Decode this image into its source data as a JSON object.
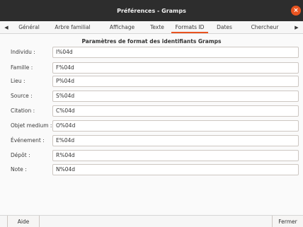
{
  "window": {
    "title": "Préférences - Gramps",
    "close_icon": "×"
  },
  "tabs": {
    "prev_icon": "◀",
    "next_icon": "▶",
    "items": [
      {
        "label": "Général"
      },
      {
        "label": "Arbre familial"
      },
      {
        "label": "Affichage"
      },
      {
        "label": "Texte"
      },
      {
        "label": "Formats ID"
      },
      {
        "label": "Dates"
      },
      {
        "label": "Chercheur"
      }
    ],
    "active_index": 4
  },
  "panel": {
    "title": "Paramètres de format des identifiants Gramps",
    "rows": [
      {
        "label": "Individu :",
        "value": "I%04d"
      },
      {
        "label": "Famille :",
        "value": "F%04d"
      },
      {
        "label": "Lieu :",
        "value": "P%04d"
      },
      {
        "label": "Source :",
        "value": "S%04d"
      },
      {
        "label": "Citation :",
        "value": "C%04d"
      },
      {
        "label": "Objet medium :",
        "value": "O%04d"
      },
      {
        "label": "Événement :",
        "value": "E%04d"
      },
      {
        "label": "Dépôt :",
        "value": "R%04d"
      },
      {
        "label": "Note :",
        "value": "N%04d"
      }
    ]
  },
  "buttons": {
    "help": "Aide",
    "close": "Fermer"
  },
  "colors": {
    "accent": "#e95420",
    "titlebar": "#2d2d2d"
  }
}
